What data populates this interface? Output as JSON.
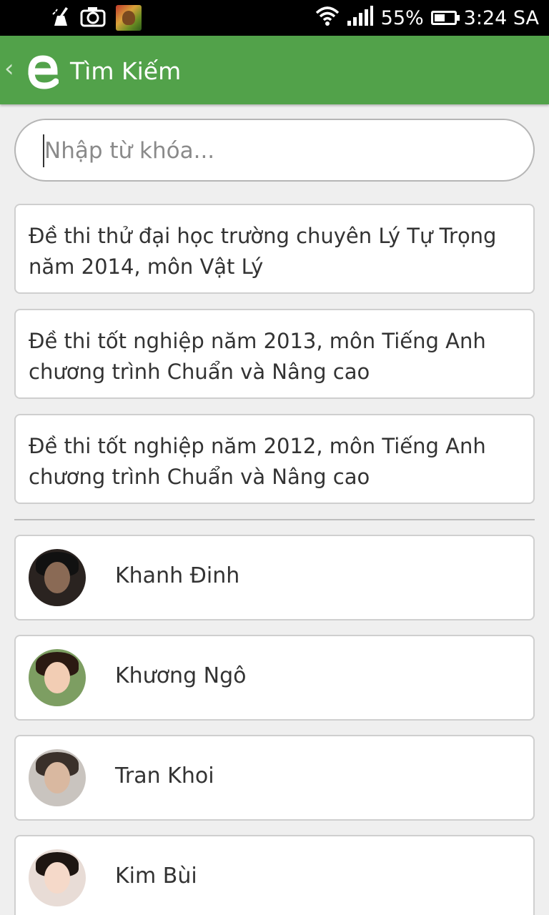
{
  "status_bar": {
    "icons_left": [
      "cleaner-icon",
      "camera-icon",
      "game-app-icon"
    ],
    "battery_percent": "55%",
    "battery_level": 0.55,
    "time": "3:24 SA"
  },
  "app_bar": {
    "title": "Tìm Kiếm",
    "accent_color": "#52a24a"
  },
  "search": {
    "placeholder": "Nhập từ khóa...",
    "value": ""
  },
  "documents": [
    {
      "title": "Đề thi thử đại học trường chuyên Lý Tự Trọng năm 2014, môn Vật Lý"
    },
    {
      "title": "Đề thi tốt nghiệp năm 2013, môn Tiếng Anh chương trình Chuẩn và Nâng cao"
    },
    {
      "title": "Đề thi tốt nghiệp năm 2012, môn Tiếng Anh chương trình Chuẩn và Nâng cao"
    }
  ],
  "users": [
    {
      "name": "Khanh Đinh"
    },
    {
      "name": "Khương Ngô"
    },
    {
      "name": "Tran Khoi"
    },
    {
      "name": "Kim Bùi"
    }
  ]
}
